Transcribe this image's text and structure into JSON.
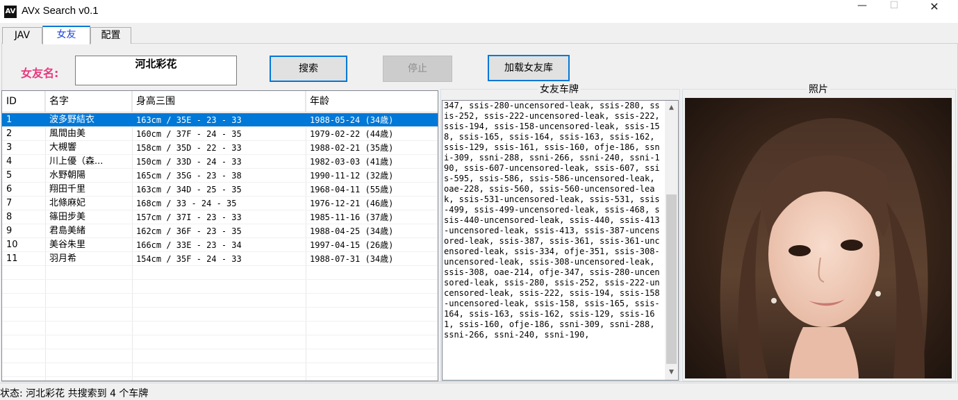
{
  "window": {
    "title": "AVx Search v0.1",
    "icon_text": "AV",
    "minimize": "—",
    "maximize": "☐",
    "close": "✕"
  },
  "tabs": [
    {
      "label": "JAV",
      "active": false
    },
    {
      "label": "女友",
      "active": true
    },
    {
      "label": "配置",
      "active": false
    }
  ],
  "search": {
    "label": "女友名:",
    "value": "河北彩花",
    "search_button": "搜索",
    "stop_button": "停止",
    "load_button": "加载女友库"
  },
  "table": {
    "columns": [
      "ID",
      "名字",
      "身高三围",
      "年龄"
    ],
    "rows": [
      {
        "id": "1",
        "name": "波多野結衣",
        "body": "163cm / 35E - 23 - 33",
        "age": "1988-05-24 (34歳)",
        "selected": true
      },
      {
        "id": "2",
        "name": "風間由美",
        "body": "160cm / 37F - 24 - 35",
        "age": "1979-02-22 (44歳)"
      },
      {
        "id": "3",
        "name": "大槻響",
        "body": "158cm / 35D - 22 - 33",
        "age": "1988-02-21 (35歳)"
      },
      {
        "id": "4",
        "name": "川上優（森...",
        "body": "150cm / 33D - 24 - 33",
        "age": "1982-03-03 (41歳)"
      },
      {
        "id": "5",
        "name": "水野朝陽",
        "body": "165cm / 35G - 23 - 38",
        "age": "1990-11-12 (32歳)"
      },
      {
        "id": "6",
        "name": "翔田千里",
        "body": "163cm / 34D - 25 - 35",
        "age": "1968-04-11 (55歳)"
      },
      {
        "id": "7",
        "name": "北條麻妃",
        "body": "168cm / 33 - 24 - 35",
        "age": "1976-12-21 (46歳)"
      },
      {
        "id": "8",
        "name": "篠田步美",
        "body": "157cm / 37I - 23 - 33",
        "age": "1985-11-16 (37歳)"
      },
      {
        "id": "9",
        "name": "君島美緒",
        "body": "162cm / 36F - 23 - 35",
        "age": "1988-04-25 (34歳)"
      },
      {
        "id": "10",
        "name": "美谷朱里",
        "body": "166cm / 33E - 23 - 34",
        "age": "1997-04-15 (26歳)"
      },
      {
        "id": "11",
        "name": "羽月希",
        "body": "154cm / 35F - 24 - 33",
        "age": "1988-07-31 (34歳)"
      }
    ]
  },
  "plates_panel": {
    "title": "女友车牌",
    "text": "347, ssis-280-uncensored-leak, ssis-280, ssis-252, ssis-222-uncensored-leak, ssis-222, ssis-194, ssis-158-uncensored-leak, ssis-158, ssis-165, ssis-164, ssis-163, ssis-162, ssis-129, ssis-161, ssis-160, ofje-186, ssni-309, ssni-288, ssni-266, ssni-240, ssni-190, ssis-607-uncensored-leak, ssis-607, ssis-595, ssis-586, ssis-586-uncensored-leak, oae-228, ssis-560, ssis-560-uncensored-leak, ssis-531-uncensored-leak, ssis-531, ssis-499, ssis-499-uncensored-leak, ssis-468, ssis-440-uncensored-leak, ssis-440, ssis-413-uncensored-leak, ssis-413, ssis-387-uncensored-leak, ssis-387, ssis-361, ssis-361-uncensored-leak, ssis-334, ofje-351, ssis-308-uncensored-leak, ssis-308-uncensored-leak, ssis-308, oae-214, ofje-347, ssis-280-uncensored-leak, ssis-280, ssis-252, ssis-222-uncensored-leak, ssis-222, ssis-194, ssis-158-uncensored-leak, ssis-158, ssis-165, ssis-164, ssis-163, ssis-162, ssis-129, ssis-161, ssis-160, ofje-186, ssni-309, ssni-288, ssni-266, ssni-240, ssni-190,"
  },
  "photo_panel": {
    "title": "照片"
  },
  "status": {
    "text": "状态:  河北彩花 共搜索到 4 个车牌"
  }
}
